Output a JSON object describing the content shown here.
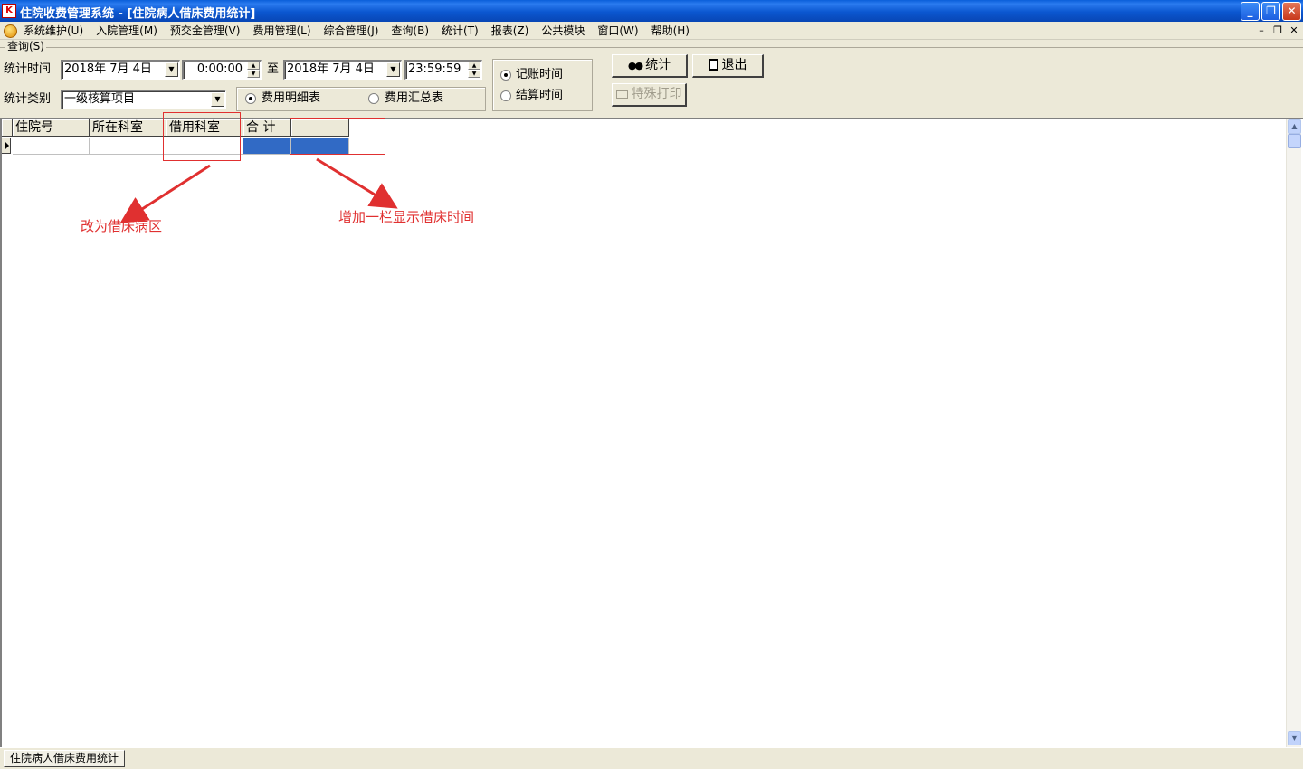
{
  "window": {
    "title": "住院收费管理系统 - [住院病人借床费用统计]",
    "icon_text": "K",
    "minimize_glyph": "_",
    "restore_glyph": "❐",
    "close_glyph": "✕"
  },
  "menu": {
    "items": [
      "系统维护(U)",
      "入院管理(M)",
      "预交金管理(V)",
      "费用管理(L)",
      "综合管理(J)",
      "查询(B)",
      "统计(T)",
      "报表(Z)",
      "公共模块",
      "窗口(W)",
      "帮助(H)"
    ],
    "mdi_minimize": "–",
    "mdi_restore": "❐",
    "mdi_close": "✕"
  },
  "query": {
    "group_title": "查询(S)",
    "time_label": "统计时间",
    "start_date": "2018年 7月 4日",
    "start_time": "0:00:00",
    "to_label": "至",
    "end_date": "2018年 7月 4日",
    "end_time": "23:59:59",
    "category_label": "统计类别",
    "category_value": "一级核算项目",
    "report_options": [
      {
        "label": "费用明细表",
        "checked": true
      },
      {
        "label": "费用汇总表",
        "checked": false
      }
    ],
    "time_basis_options": [
      {
        "label": "记账时间",
        "checked": true
      },
      {
        "label": "结算时间",
        "checked": false
      }
    ],
    "stat_button": "统计",
    "exit_button": "退出",
    "print_button": "特殊打印",
    "stat_icon": "binoculars-icon",
    "exit_icon": "exit-door-icon",
    "print_icon": "printer-icon"
  },
  "grid": {
    "columns": [
      "住院号",
      "所在科室",
      "借用科室",
      "合 计",
      ""
    ]
  },
  "annotations": {
    "note_dept": "改为借床病区",
    "note_add_column": "增加一栏显示借床时间",
    "color": "#E03030"
  },
  "status": {
    "tab": "住院病人借床费用统计"
  }
}
